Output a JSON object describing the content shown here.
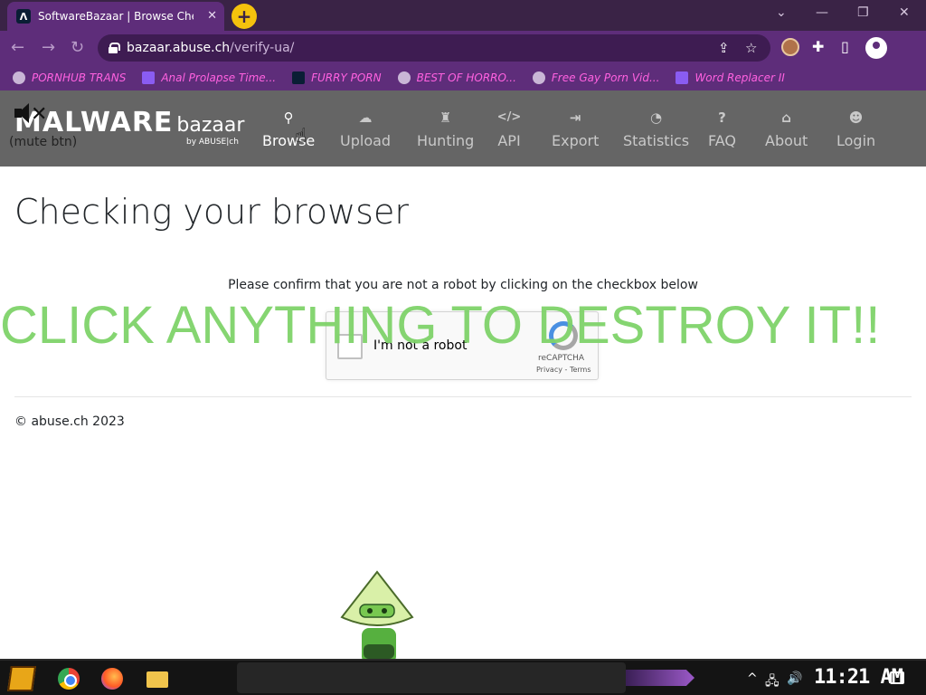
{
  "browser": {
    "tab_title": "SoftwareBazaar | Browse Chec",
    "tab_favicon": "Λ",
    "tab_close": "✕",
    "new_tab": "+",
    "url_host": "bazaar.abuse.ch",
    "url_path": "/verify-ua/",
    "window_controls": {
      "dropdown": "⌄",
      "minimize": "—",
      "restore": "❐",
      "close": "✕"
    },
    "nav_icons": {
      "back": "←",
      "forward": "→",
      "reload": "↻"
    },
    "omnibox_icons": {
      "share": "⇪",
      "star": "☆"
    },
    "toolbar_icons": {
      "extensions": "✚",
      "sidepanel": "▯"
    }
  },
  "bookmarks": [
    {
      "label": "PORNHUB TRANS",
      "icon": "globe-icon"
    },
    {
      "label": "Anal Prolapse Time...",
      "icon": "bookmark-square-icon"
    },
    {
      "label": "FURRY PORN",
      "icon": "lambda-logo-icon"
    },
    {
      "label": "BEST OF HORRO...",
      "icon": "globe-icon"
    },
    {
      "label": "Free Gay Porn Vid...",
      "icon": "robot-icon"
    },
    {
      "label": "Word Replacer II",
      "icon": "wr-icon"
    }
  ],
  "site": {
    "brand_big": "MALWARE",
    "brand_small": "bazaar",
    "brand_sub": "by ABUSE|ch",
    "mute_label": "(mute btn)",
    "mute_x": "✕",
    "nav": [
      {
        "label": "Browse",
        "icon": "search-icon",
        "glyph": "⚲"
      },
      {
        "label": "Upload",
        "icon": "cloud-upload-icon",
        "glyph": "☁"
      },
      {
        "label": "Hunting",
        "icon": "rook-icon",
        "glyph": "♜"
      },
      {
        "label": "API",
        "icon": "code-icon",
        "glyph": "</>"
      },
      {
        "label": "Export",
        "icon": "export-icon",
        "glyph": "⇥"
      },
      {
        "label": "Statistics",
        "icon": "pie-chart-icon",
        "glyph": "◔"
      },
      {
        "label": "FAQ",
        "icon": "question-icon",
        "glyph": "?"
      },
      {
        "label": "About",
        "icon": "institution-icon",
        "glyph": "⌂"
      },
      {
        "label": "Login",
        "icon": "user-icon",
        "glyph": "☻"
      }
    ],
    "cursor_glyph": "☝"
  },
  "page": {
    "title": "Checking your browser",
    "confirm_text": "Please confirm that you are not a robot by clicking on the checkbox below",
    "recaptcha": {
      "label": "I'm not a robot",
      "brand": "reCAPTCHA",
      "links": "Privacy - Terms"
    },
    "overlay": "CLICK ANYTHING TO DESTROY IT!!",
    "footer": "© abuse.ch 2023"
  },
  "taskbar": {
    "clock": "11:21 AM",
    "tray_icons": {
      "chevron": "^",
      "network": "🖧",
      "volume": "🔊"
    }
  },
  "colors": {
    "browser_frame": "#5e2d7a",
    "bookmark_text": "#ff61e0",
    "site_nav": "#656565",
    "overlay_text": "#7fd36a"
  }
}
